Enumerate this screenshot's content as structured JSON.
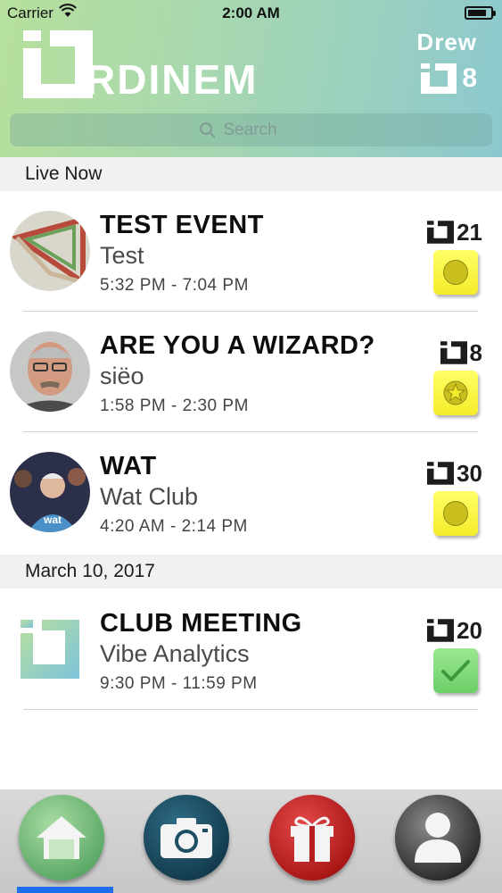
{
  "status_bar": {
    "carrier": "Carrier",
    "time": "2:00 AM",
    "battery_level": 0.85
  },
  "header": {
    "logo_text": "RDINEM",
    "user_name": "Drew",
    "user_points": "8",
    "points_icon": "ordinem-logo-icon",
    "search_placeholder": "Search",
    "gradient_colors": [
      "#b7e09c",
      "#8cc8cf"
    ]
  },
  "sections": [
    {
      "title": "Live Now",
      "events": [
        {
          "title": "TEST EVENT",
          "subtitle": "Test",
          "time": "5:32 PM - 7:04 PM",
          "points": "21",
          "status": "yellow-dot",
          "avatar": "penrose-triangle-image"
        },
        {
          "title": "ARE YOU A WIZARD?",
          "subtitle": "siëo",
          "time": "1:58 PM - 2:30 PM",
          "points": "8",
          "status": "yellow-star",
          "avatar": "man-with-glasses-photo"
        },
        {
          "title": "WAT",
          "subtitle": "Wat Club",
          "time": "4:20 AM - 2:14 PM",
          "points": "30",
          "status": "yellow-dot",
          "avatar": "crowd-person-photo"
        }
      ]
    },
    {
      "title": "March 10, 2017",
      "events": [
        {
          "title": "CLUB MEETING",
          "subtitle": "Vibe Analytics",
          "time": "9:30 PM - 11:59 PM",
          "points": "20",
          "status": "green-check",
          "avatar": "vibe-analytics-logo"
        }
      ]
    }
  ],
  "tab_bar": {
    "tabs": [
      "home-icon",
      "camera-icon",
      "gift-icon",
      "profile-icon"
    ],
    "active_tab": "home-icon",
    "indicator_color": "#1e6ef0"
  }
}
